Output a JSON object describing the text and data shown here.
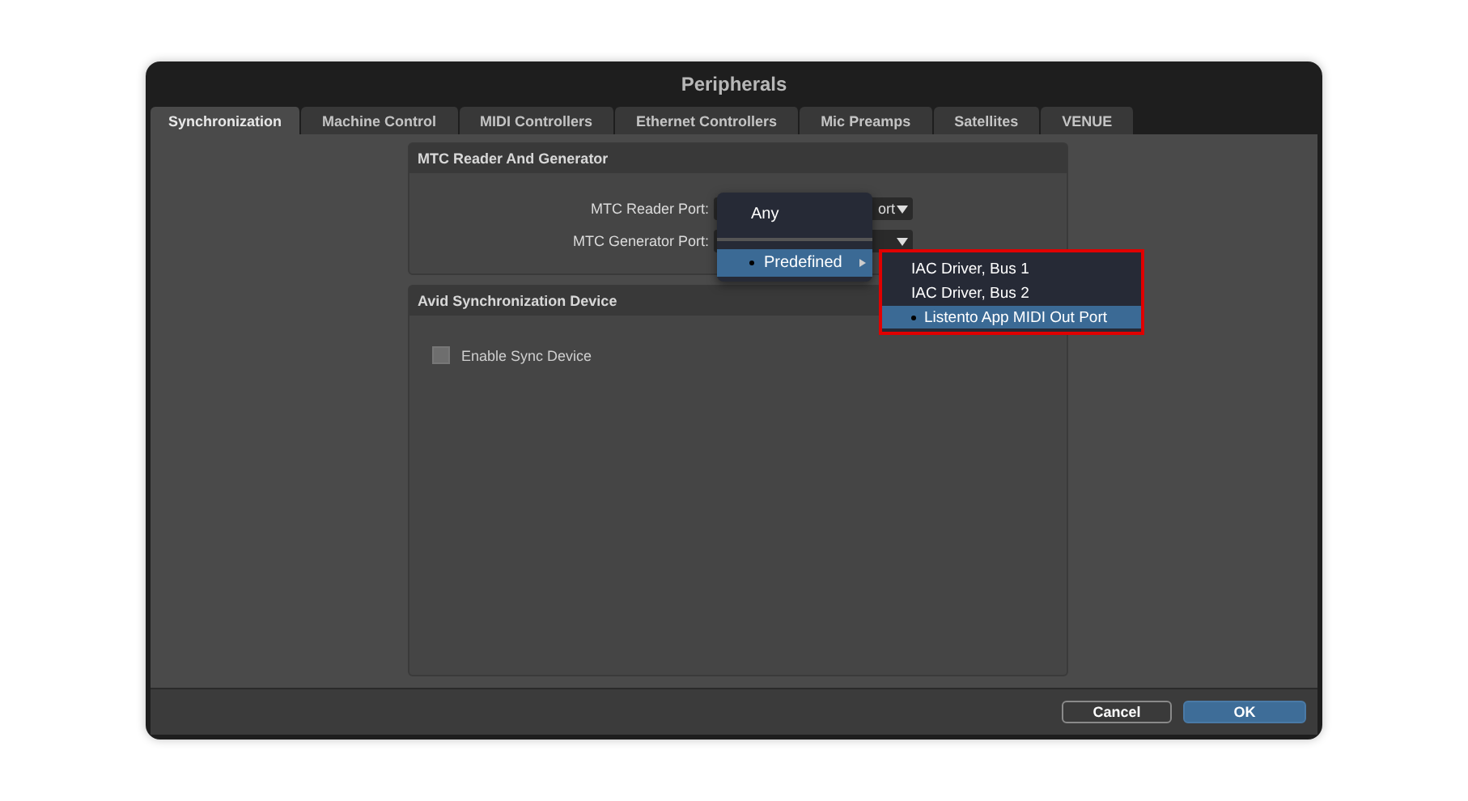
{
  "window": {
    "title": "Peripherals"
  },
  "tabs": [
    {
      "label": "Synchronization",
      "selected": true
    },
    {
      "label": "Machine Control",
      "selected": false
    },
    {
      "label": "MIDI Controllers",
      "selected": false
    },
    {
      "label": "Ethernet Controllers",
      "selected": false
    },
    {
      "label": "Mic Preamps",
      "selected": false
    },
    {
      "label": "Satellites",
      "selected": false
    },
    {
      "label": "VENUE",
      "selected": false
    }
  ],
  "mtc_panel": {
    "title": "MTC Reader And Generator",
    "fields": [
      {
        "label": "MTC Reader Port:",
        "value": "ort"
      },
      {
        "label": "MTC Generator Port:"
      }
    ]
  },
  "sync_panel": {
    "title": "Avid Synchronization Device",
    "checkbox": {
      "label": "Enable Sync Device",
      "checked": false
    }
  },
  "port_menu": {
    "items": [
      {
        "label": "Any",
        "selected": false,
        "highlighted": false,
        "submenu": false
      },
      {
        "label": "Predefined",
        "selected": true,
        "highlighted": true,
        "submenu": true
      }
    ]
  },
  "submenu": {
    "items": [
      {
        "label": "IAC Driver, Bus 1",
        "selected": false
      },
      {
        "label": "IAC Driver, Bus 2",
        "selected": false
      },
      {
        "label": "Listento App MIDI Out Port",
        "selected": true
      }
    ]
  },
  "buttons": [
    {
      "label": "Cancel",
      "kind": "secondary"
    },
    {
      "label": "OK",
      "kind": "primary"
    }
  ]
}
